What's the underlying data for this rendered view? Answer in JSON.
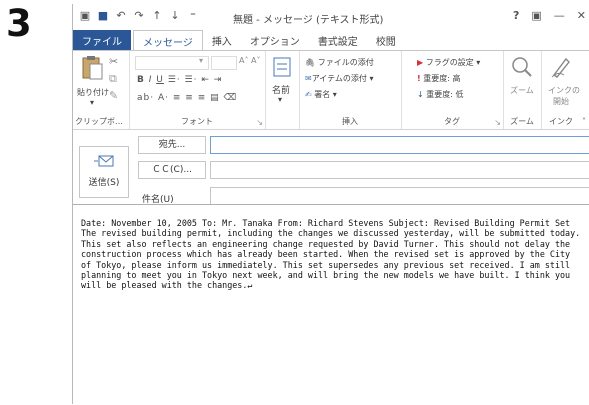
{
  "step_number": "3",
  "window": {
    "title": "無題 - メッセージ (テキスト形式)",
    "controls": [
      "?",
      "▣",
      "—",
      "✕"
    ]
  },
  "tabs": [
    {
      "label": "ファイル"
    },
    {
      "label": "メッセージ"
    },
    {
      "label": "挿入"
    },
    {
      "label": "オプション"
    },
    {
      "label": "書式設定"
    },
    {
      "label": "校閲"
    }
  ],
  "ribbon": {
    "clipboard": {
      "paste": "貼り付け",
      "group": "クリップボ…"
    },
    "font": {
      "group": "フォント"
    },
    "names": {
      "label": "名前"
    },
    "include": {
      "attach_file": "ファイルの添付",
      "attach_item": "アイテムの添付",
      "signature": "署名",
      "group": "挿入"
    },
    "tags": {
      "follow_up": "フラグの設定",
      "high_importance": "重要度: 高",
      "low_importance": "重要度: 低",
      "group": "タグ"
    },
    "zoom": {
      "label": "ズーム",
      "group": "ズーム"
    },
    "ink": {
      "label1": "インクの",
      "label2": "開始",
      "group": "インク"
    }
  },
  "compose": {
    "send": "送信(S)",
    "to_button": "宛先...",
    "cc_button": "ＣＣ(C)...",
    "subject_label": "件名(U)"
  },
  "body_text": "Date: November 10, 2005 To: Mr. Tanaka From: Richard Stevens Subject: Revised Building Permit Set  The revised building permit, including the changes we discussed yesterday, will be submitted today. This set also reflects an engineering change requested by David Turner.  This should not delay the construction process which has already been started. When the revised set is approved by the City of Tokyo, please inform us immediately. This set supersedes any previous set received.  I am still planning to meet you in Tokyo next week, and will bring the new models we have built. I think you will be pleased with the changes.↵",
  "colors": {
    "file_tab": "#2b5797",
    "accent": "#2b5797",
    "flag": "#d13438"
  }
}
